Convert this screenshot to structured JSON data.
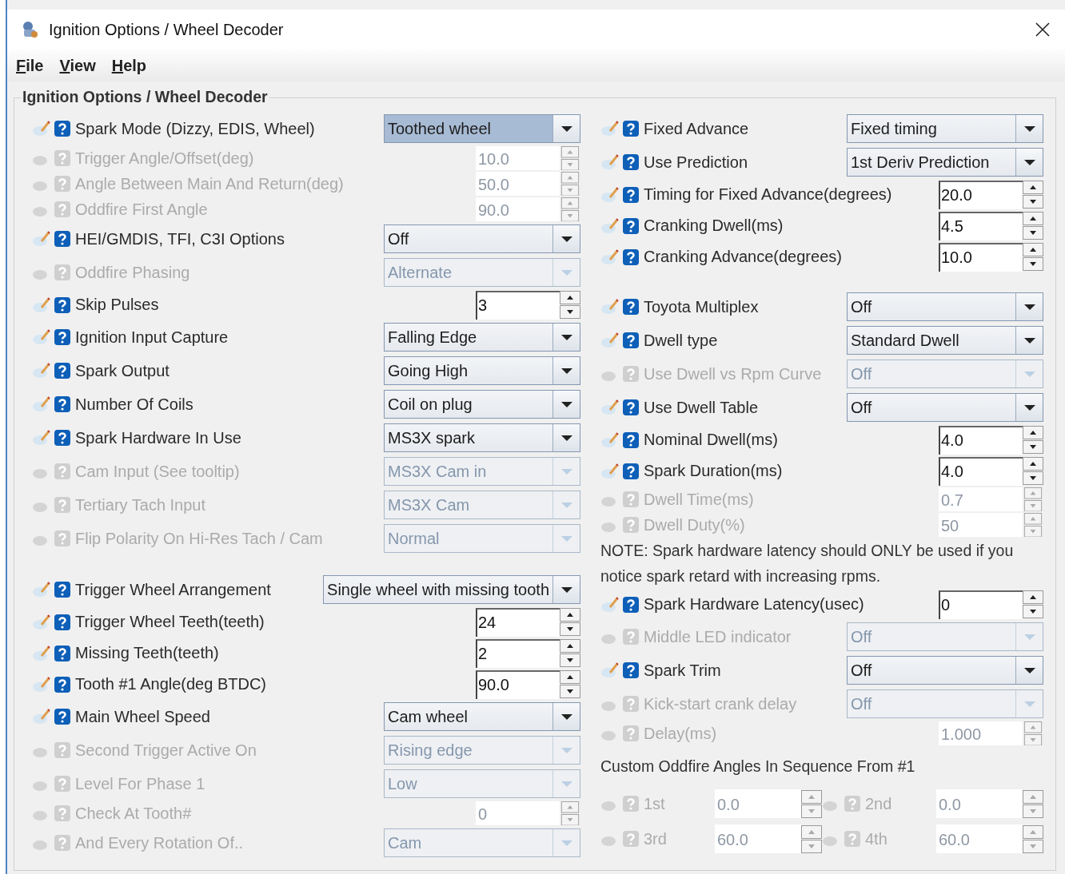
{
  "window": {
    "title": "Ignition Options / Wheel Decoder"
  },
  "menu": [
    {
      "label": "File"
    },
    {
      "label": "View"
    },
    {
      "label": "Help"
    }
  ],
  "panel": {
    "title": "Ignition Options / Wheel Decoder",
    "columns": [
      [
        {
          "kind": "combo",
          "label": "Spark Mode (Dizzy, EDIS, Wheel)",
          "value": "Toothed wheel",
          "disabled": false,
          "focused": true
        },
        {
          "kind": "spinner",
          "label": "Trigger Angle/Offset(deg)",
          "value": "10.0",
          "disabled": true
        },
        {
          "kind": "spinner",
          "label": "Angle Between Main And Return(deg)",
          "value": "50.0",
          "disabled": true
        },
        {
          "kind": "spinner",
          "label": "Oddfire First Angle",
          "value": "90.0",
          "disabled": true
        },
        {
          "kind": "combo",
          "label": "HEI/GMDIS, TFI, C3I Options",
          "value": "Off",
          "disabled": false,
          "focused": false
        },
        {
          "kind": "combo",
          "label": "Oddfire Phasing",
          "value": "Alternate",
          "disabled": true,
          "focused": false
        },
        {
          "kind": "spinner",
          "label": "Skip Pulses",
          "value": "3",
          "disabled": false
        },
        {
          "kind": "combo",
          "label": "Ignition Input Capture",
          "value": "Falling Edge",
          "disabled": false,
          "focused": false
        },
        {
          "kind": "combo",
          "label": "Spark Output",
          "value": "Going High",
          "disabled": false,
          "focused": false
        },
        {
          "kind": "combo",
          "label": "Number Of Coils",
          "value": "Coil on plug",
          "disabled": false,
          "focused": false
        },
        {
          "kind": "combo",
          "label": "Spark Hardware In Use",
          "value": "MS3X spark",
          "disabled": false,
          "focused": false
        },
        {
          "kind": "combo",
          "label": "Cam Input (See tooltip)",
          "value": "MS3X Cam in",
          "disabled": true,
          "focused": false
        },
        {
          "kind": "combo",
          "label": "Tertiary Tach Input",
          "value": "MS3X Cam",
          "disabled": true,
          "focused": false
        },
        {
          "kind": "combo",
          "label": "Flip Polarity On Hi-Res Tach / Cam",
          "value": "Normal",
          "disabled": true,
          "focused": false
        },
        {
          "kind": "gap"
        },
        {
          "kind": "combo",
          "label": "Trigger Wheel Arrangement",
          "value": "Single wheel with missing tooth",
          "disabled": false,
          "focused": false
        },
        {
          "kind": "spinner",
          "label": "Trigger Wheel Teeth(teeth)",
          "value": "24",
          "disabled": false
        },
        {
          "kind": "spinner",
          "label": "Missing Teeth(teeth)",
          "value": "2",
          "disabled": false
        },
        {
          "kind": "spinner",
          "label": "Tooth #1 Angle(deg BTDC)",
          "value": "90.0",
          "disabled": false
        },
        {
          "kind": "combo",
          "label": "Main Wheel Speed",
          "value": "Cam wheel",
          "disabled": false,
          "focused": false
        },
        {
          "kind": "combo",
          "label": "Second Trigger Active On",
          "value": "Rising edge",
          "disabled": true,
          "focused": false
        },
        {
          "kind": "combo",
          "label": "Level For Phase 1",
          "value": "Low",
          "disabled": true,
          "focused": false
        },
        {
          "kind": "spinner",
          "label": "Check At Tooth#",
          "value": "0",
          "disabled": true
        },
        {
          "kind": "combo",
          "label": "And Every Rotation Of..",
          "value": "Cam",
          "disabled": true,
          "focused": false
        }
      ],
      [
        {
          "kind": "combo",
          "label": "Fixed Advance",
          "value": "Fixed timing",
          "disabled": false,
          "focused": false
        },
        {
          "kind": "combo",
          "label": "Use Prediction",
          "value": "1st Deriv Prediction",
          "disabled": false,
          "focused": false
        },
        {
          "kind": "spinner",
          "label": "Timing for Fixed Advance(degrees)",
          "value": "20.0",
          "disabled": false
        },
        {
          "kind": "spinner",
          "label": "Cranking Dwell(ms)",
          "value": "4.5",
          "disabled": false
        },
        {
          "kind": "spinner",
          "label": "Cranking Advance(degrees)",
          "value": "10.0",
          "disabled": false
        },
        {
          "kind": "gap"
        },
        {
          "kind": "combo",
          "label": "Toyota Multiplex",
          "value": "Off",
          "disabled": false,
          "focused": false
        },
        {
          "kind": "combo",
          "label": "Dwell type",
          "value": "Standard Dwell",
          "disabled": false,
          "focused": false
        },
        {
          "kind": "combo",
          "label": "Use Dwell vs Rpm Curve",
          "value": "Off",
          "disabled": true,
          "focused": false
        },
        {
          "kind": "combo",
          "label": "Use Dwell Table",
          "value": "Off",
          "disabled": false,
          "focused": false
        },
        {
          "kind": "spinner",
          "label": "Nominal Dwell(ms)",
          "value": "4.0",
          "disabled": false
        },
        {
          "kind": "spinner",
          "label": "Spark Duration(ms)",
          "value": "4.0",
          "disabled": false
        },
        {
          "kind": "spinner",
          "label": "Dwell Time(ms)",
          "value": "0.7",
          "disabled": true
        },
        {
          "kind": "spinner",
          "label": "Dwell Duty(%)",
          "value": "50",
          "disabled": true
        },
        {
          "kind": "note",
          "text": "NOTE: Spark hardware latency should ONLY be used if you notice spark retard with increasing rpms."
        },
        {
          "kind": "spinner",
          "label": "Spark Hardware Latency(usec)",
          "value": "0",
          "disabled": false
        },
        {
          "kind": "combo",
          "label": "Middle LED indicator",
          "value": "Off",
          "disabled": true,
          "focused": false
        },
        {
          "kind": "combo",
          "label": "Spark Trim",
          "value": "Off",
          "disabled": false,
          "focused": false
        },
        {
          "kind": "combo",
          "label": "Kick-start crank delay",
          "value": "Off",
          "disabled": true,
          "focused": false
        },
        {
          "kind": "spinner",
          "label": "Delay(ms)",
          "value": "1.000",
          "disabled": true
        },
        {
          "kind": "heading",
          "text": "Custom Oddfire Angles In Sequence From #1"
        },
        {
          "kind": "pair",
          "items": [
            {
              "label": "1st",
              "value": "0.0",
              "disabled": true
            },
            {
              "label": "2nd",
              "value": "0.0",
              "disabled": true
            }
          ]
        },
        {
          "kind": "pair",
          "items": [
            {
              "label": "3rd",
              "value": "60.0",
              "disabled": true
            },
            {
              "label": "4th",
              "value": "60.0",
              "disabled": true
            }
          ]
        }
      ]
    ]
  }
}
